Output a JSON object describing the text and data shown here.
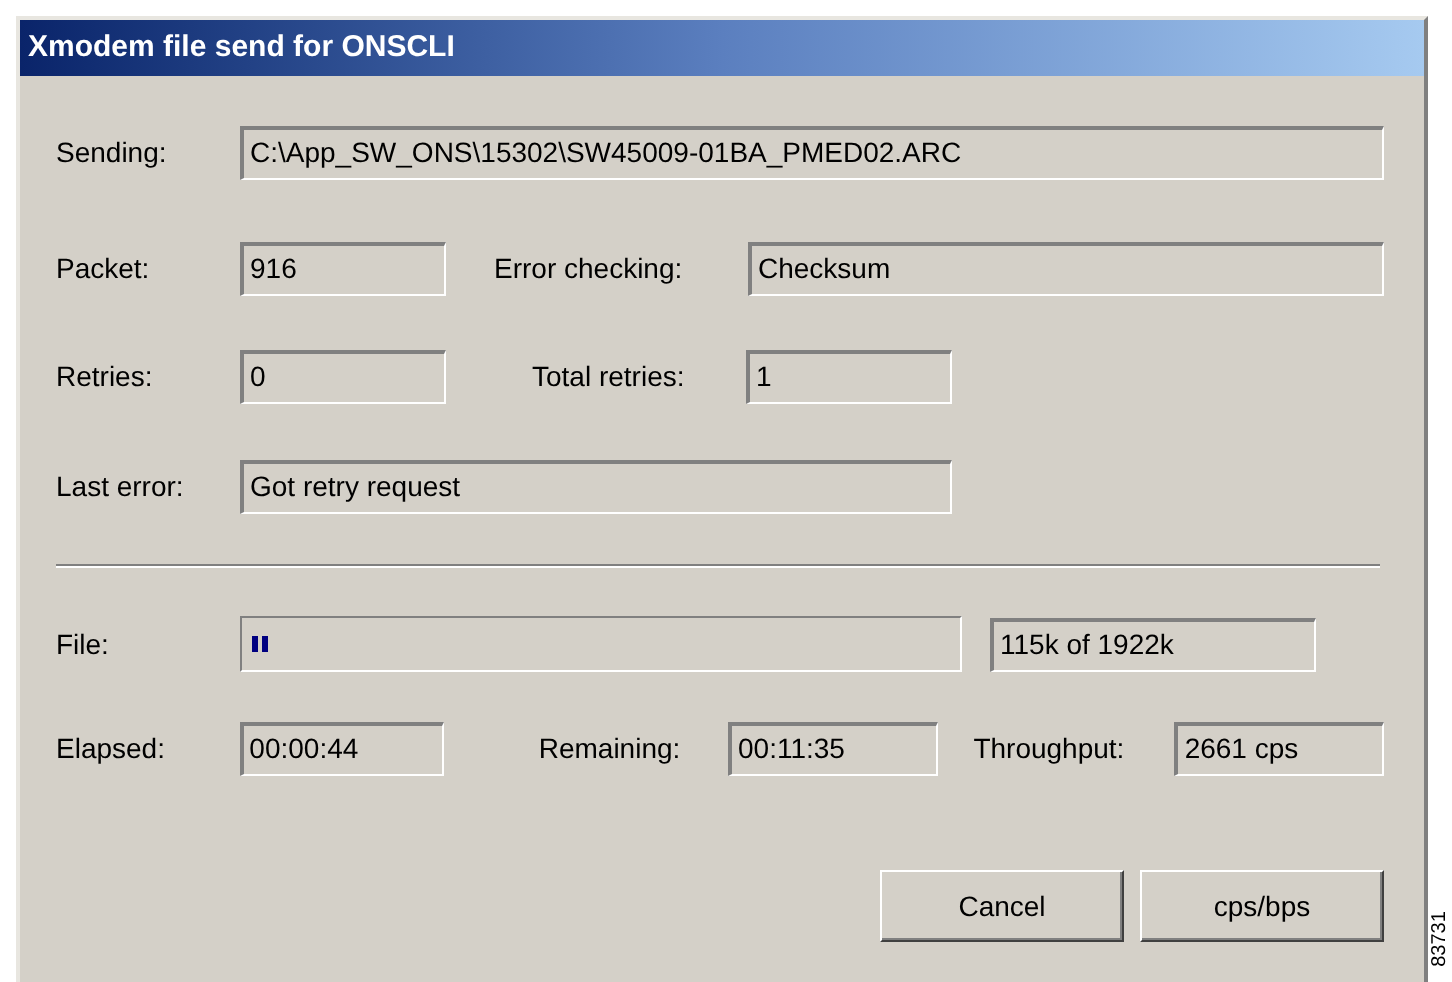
{
  "window": {
    "title": "Xmodem file send for ONSCLI"
  },
  "sending": {
    "label": "Sending:",
    "value": "C:\\App_SW_ONS\\15302\\SW45009-01BA_PMED02.ARC"
  },
  "packet": {
    "label": "Packet:",
    "value": "916"
  },
  "error_checking": {
    "label": "Error checking:",
    "value": "Checksum"
  },
  "retries": {
    "label": "Retries:",
    "value": "0"
  },
  "total_retries": {
    "label": "Total retries:",
    "value": "1"
  },
  "last_error": {
    "label": "Last error:",
    "value": "Got retry request"
  },
  "file": {
    "label": "File:",
    "level": 0.03,
    "value": "115k of 1922k"
  },
  "elapsed": {
    "label": "Elapsed:",
    "value": "00:00:44"
  },
  "remaining": {
    "label": "Remaining:",
    "value": "00:11:35"
  },
  "throughput": {
    "label": "Throughput:",
    "value": "2661 cps"
  },
  "buttons": [
    "Cancel",
    "cps/bps"
  ],
  "figure_id": "83731"
}
